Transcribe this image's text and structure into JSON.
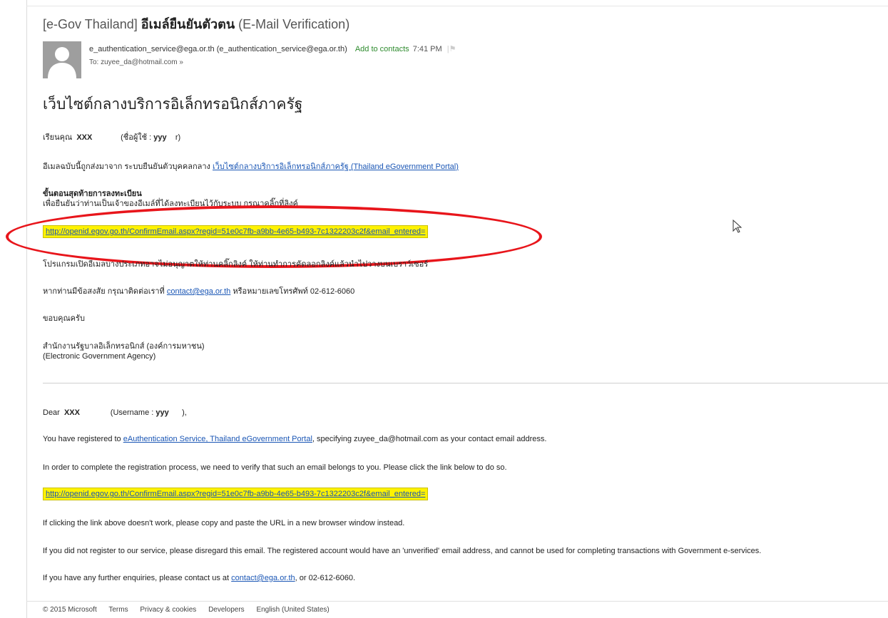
{
  "email": {
    "subject_prefix": "[e-Gov Thailand]",
    "subject_thai": "อีเมล์ยืนยันตัวตน",
    "subject_suffix": "(E-Mail Verification)",
    "sender_name": "e_authentication_service@ega.or.th",
    "sender_address": "(e_authentication_service@ega.or.th)",
    "add_to_contacts": "Add to contacts",
    "time": "7:41 PM",
    "to": "To: zuyee_da@hotmail.com"
  },
  "thai": {
    "site_title": "เว็บไซต์กลางบริการอิเล็กทรอนิกส์ภาครัฐ",
    "greeting_prefix": "เรียนคุณ",
    "name": "XXX",
    "username_label": "(ชื่อผู้ใช้ :",
    "username": "yyy",
    "username_close": "r)",
    "intro": "อีเมลฉบับนี้ถูกส่งมาจาก ระบบยืนยันตัวบุคคลกลาง",
    "portal_link": "เว็บไซต์กลางบริการอิเล็กทรอนิกส์ภาครัฐ (Thailand eGovernment Portal)",
    "final_step_heading": "ขั้นตอนสุดท้ายการลงทะเบียน",
    "final_step_text": "เพื่อยืนยันว่าท่านเป็นเจ้าของอีเมล์ที่ได้ลงทะเบียนไว้กับระบบ กรุณาคลิ๊กที่ลิงค์",
    "verify_link": "http://openid.egov.go.th/ConfirmEmail.aspx?regid=51e0c7fb-a9bb-4e65-b493-7c1322203c2f&email_entered=",
    "browser_note": "โปรแกรมเปิดอีเมลบางประเภทอาจไม่อนุญาตให้ท่านคลิ๊กลิงค์ ให้ท่านทำการคัดลอกลิงค์แล้วนำไปวางบนเบราว์เซอร์",
    "contact_prefix": "หากท่านมีข้อสงสัย กรุณาติดต่อเราที่",
    "contact_email": "contact@ega.or.th",
    "contact_suffix": "หรือหมายเลขโทรศัพท์ 02-612-6060",
    "thanks": "ขอบคุณครับ",
    "org_thai": "สำนักงานรัฐบาลอิเล็กทรอนิกส์ (องค์การมหาชน)",
    "org_english": "(Electronic Government Agency)"
  },
  "english": {
    "dear": "Dear",
    "name": "XXX",
    "username_label": "(Username :",
    "username": "yyy",
    "username_close": "),",
    "registered_prefix": "You have registered to",
    "registered_link": "eAuthentication Service, Thailand eGovernment Portal",
    "registered_suffix": ", specifying zuyee_da@hotmail.com as your contact email address.",
    "verify_text": "In order to complete the registration process, we need to verify that such an email belongs to you. Please click the link below to do so.",
    "verify_link": "http://openid.egov.go.th/ConfirmEmail.aspx?regid=51e0c7fb-a9bb-4e65-b493-7c1322203c2f&email_entered=",
    "copy_note": "If clicking the link above doesn't work, please copy and paste the URL in a new browser window instead.",
    "disregard_note": "If you did not register to our service, please disregard this email. The registered account would have an 'unverified' email address, and cannot be used for completing transactions with Government e-services.",
    "enquiry_prefix": "If you have any further enquiries, please contact us at",
    "contact_email": "contact@ega.or.th",
    "enquiry_suffix": ", or 02-612-6060."
  },
  "footer": {
    "copyright": "© 2015 Microsoft",
    "terms": "Terms",
    "privacy": "Privacy & cookies",
    "developers": "Developers",
    "language": "English (United States)"
  },
  "colors": {
    "highlight": "#fff200",
    "annotation_red": "#e8151b",
    "link": "#1a56b5"
  }
}
